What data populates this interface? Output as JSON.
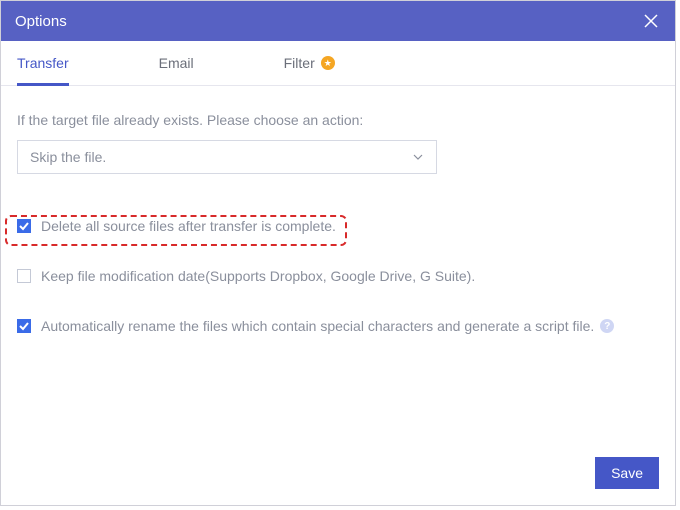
{
  "window": {
    "title": "Options"
  },
  "tabs": {
    "transfer": "Transfer",
    "email": "Email",
    "filter": "Filter"
  },
  "body": {
    "instruction": "If the target file already exists. Please choose an action:",
    "select_value": "Skip the file."
  },
  "options": {
    "delete_source": "Delete all source files after transfer is complete.",
    "keep_mod_date": "Keep file modification date(Supports Dropbox, Google Drive, G Suite).",
    "auto_rename": "Automatically rename the files which contain special characters and generate a script file."
  },
  "buttons": {
    "save": "Save"
  }
}
